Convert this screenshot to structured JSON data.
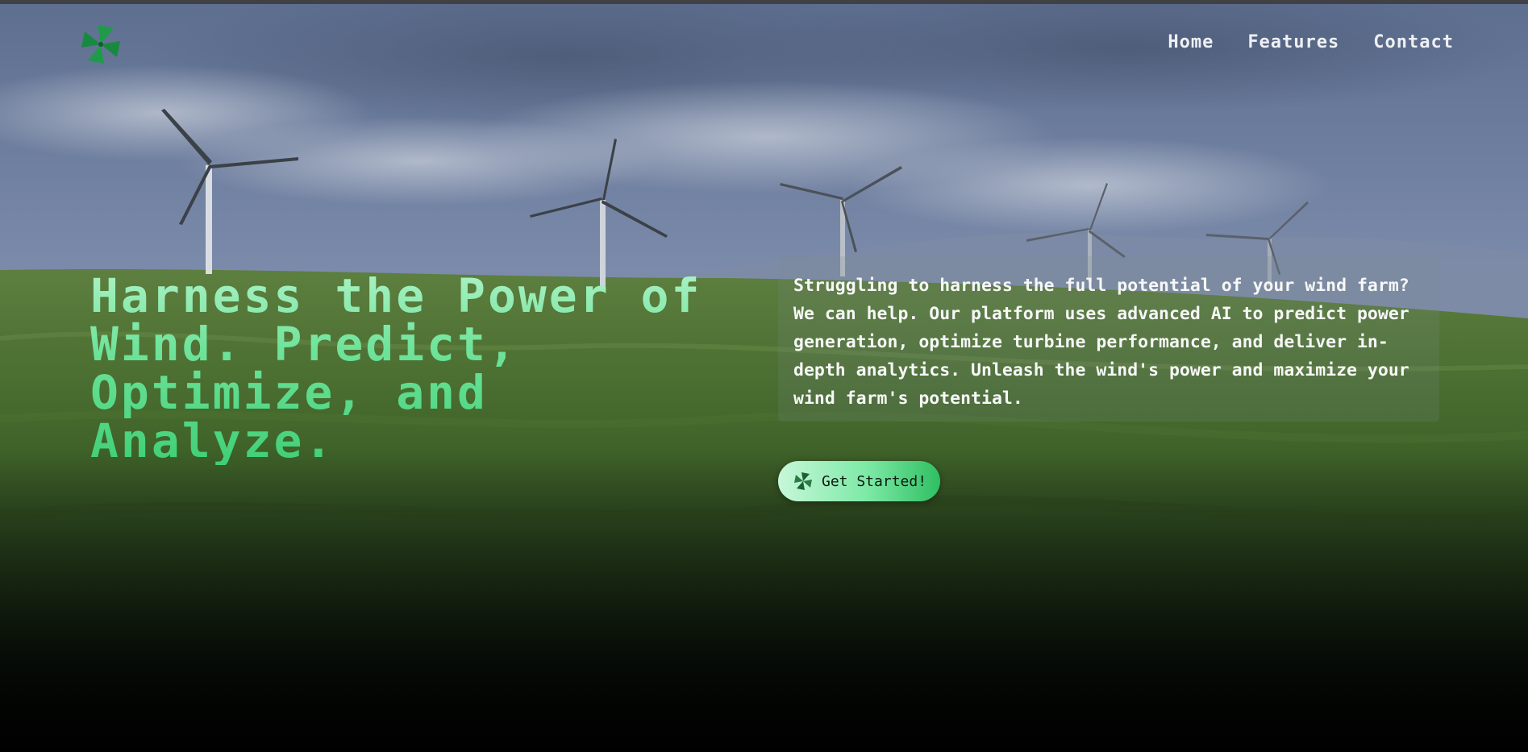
{
  "nav": {
    "logo_icon": "pinwheel-icon",
    "links": [
      {
        "label": "Home"
      },
      {
        "label": "Features"
      },
      {
        "label": "Contact"
      }
    ]
  },
  "hero": {
    "headline": "Harness the Power of Wind. Predict, Optimize, and Analyze.",
    "description": "Struggling to harness the full potential of your wind farm? We can help. Our platform uses advanced AI to predict power generation, optimize turbine performance, and deliver in-depth analytics. Unleash the wind's power and maximize your wind farm's potential.",
    "cta": {
      "label": "Get Started!",
      "icon": "pinwheel-icon"
    },
    "background_image": "wind-turbines-on-green-hills"
  },
  "colors": {
    "accent": "#3fcf76",
    "accent_light": "#a9f2c4",
    "logo_green": "#1f9a4a",
    "nav_text": "#eef0f4"
  }
}
